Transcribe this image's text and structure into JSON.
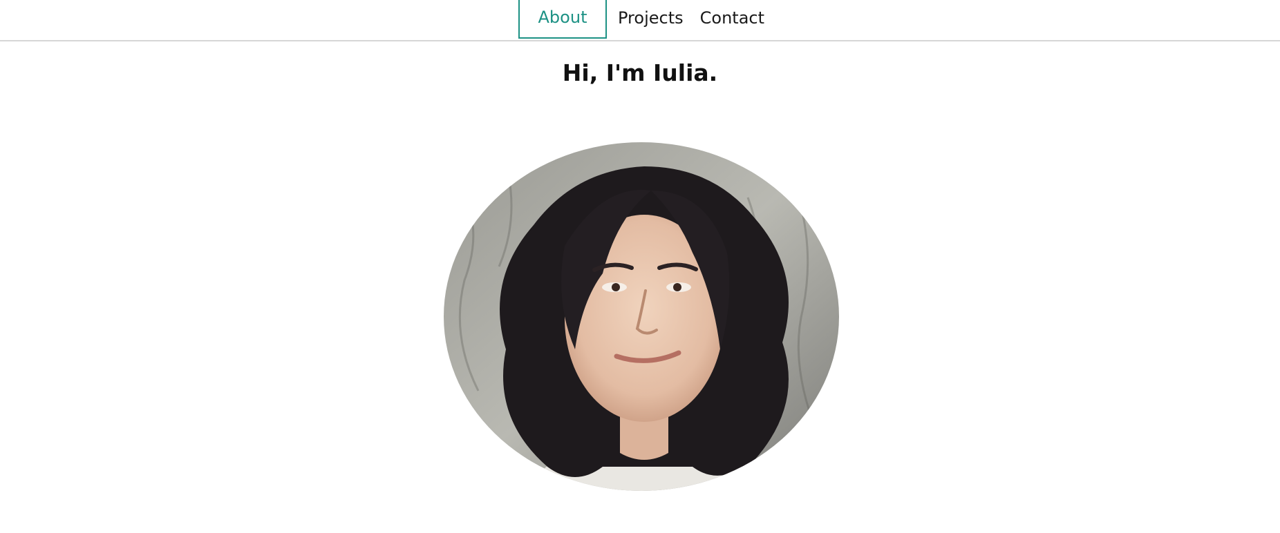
{
  "nav": {
    "items": [
      {
        "label": "About",
        "active": true
      },
      {
        "label": "Projects",
        "active": false
      },
      {
        "label": "Contact",
        "active": false
      }
    ]
  },
  "hero": {
    "heading": "Hi, I'm Iulia."
  },
  "colors": {
    "accent": "#1c9184",
    "divider": "#d6d6d6",
    "text": "#111111"
  },
  "icons": {
    "portrait": "profile-photo"
  }
}
